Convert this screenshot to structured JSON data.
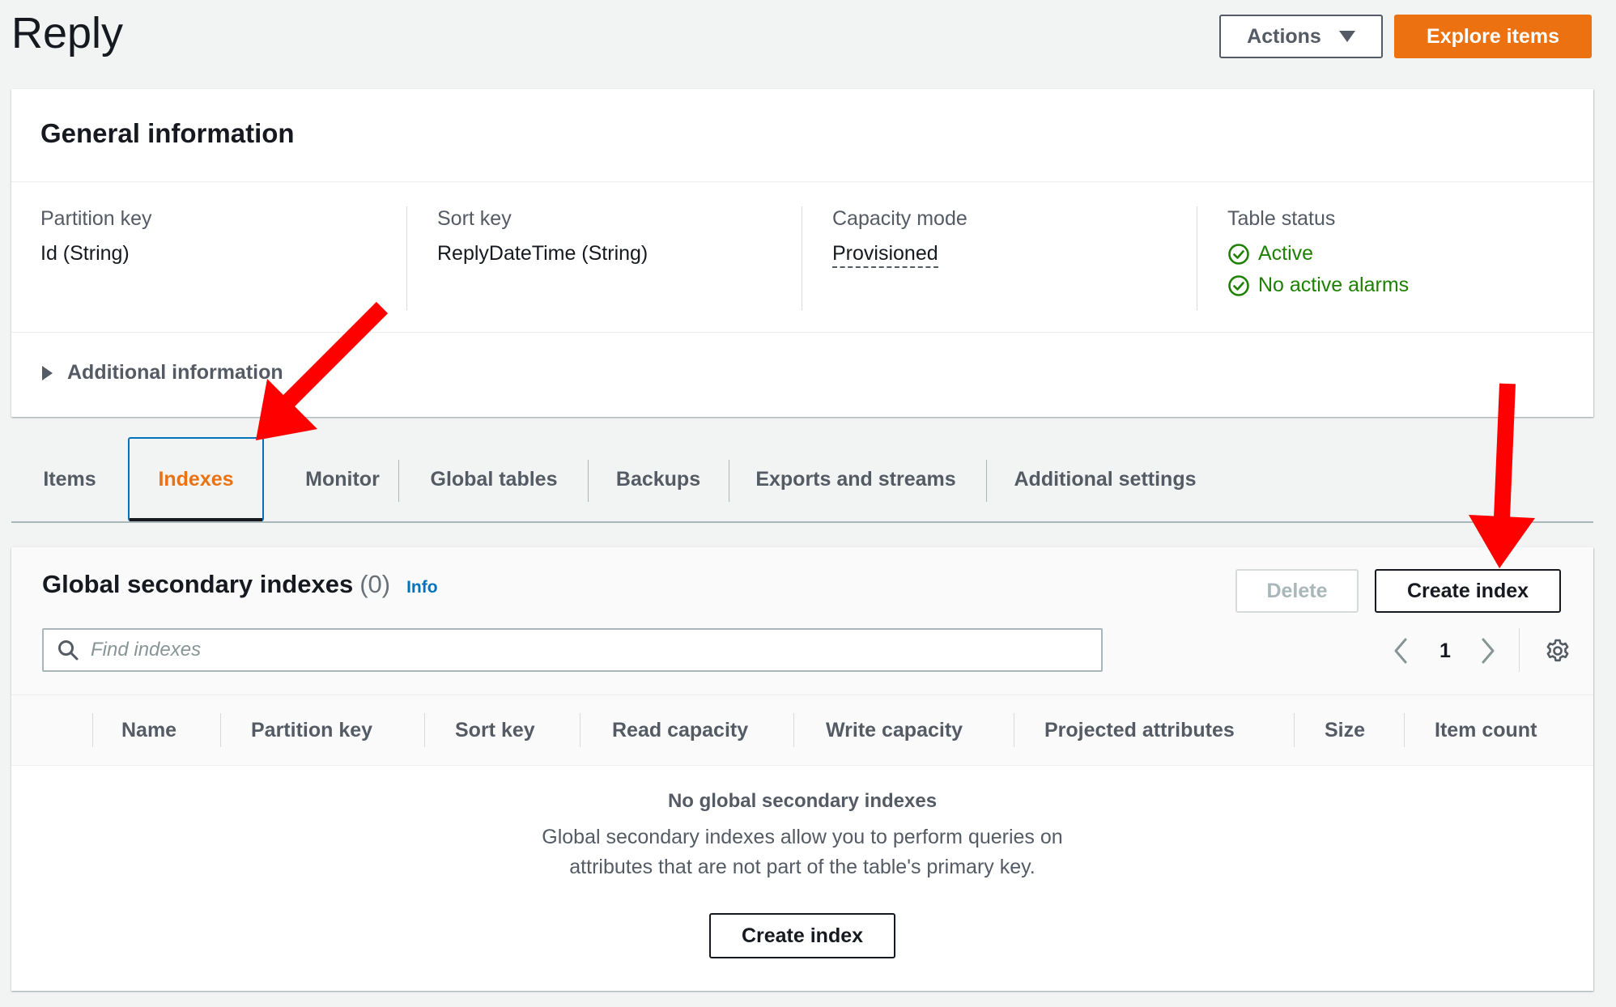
{
  "header": {
    "title": "Reply",
    "actions_label": "Actions",
    "explore_label": "Explore items"
  },
  "general": {
    "title": "General information",
    "partition_key_label": "Partition key",
    "partition_key_value": "Id (String)",
    "sort_key_label": "Sort key",
    "sort_key_value": "ReplyDateTime (String)",
    "capacity_label": "Capacity mode",
    "capacity_value": "Provisioned",
    "status_label": "Table status",
    "status_active": "Active",
    "status_alarms": "No active alarms",
    "additional_info": "Additional information"
  },
  "tabs": [
    {
      "label": "Items"
    },
    {
      "label": "Indexes"
    },
    {
      "label": "Monitor"
    },
    {
      "label": "Global tables"
    },
    {
      "label": "Backups"
    },
    {
      "label": "Exports and streams"
    },
    {
      "label": "Additional settings"
    }
  ],
  "active_tab": "Indexes",
  "gsi": {
    "title": "Global secondary indexes",
    "count": "(0)",
    "info": "Info",
    "delete_label": "Delete",
    "create_label": "Create index",
    "search_placeholder": "Find indexes",
    "page": "1",
    "columns": [
      "Name",
      "Partition key",
      "Sort key",
      "Read capacity",
      "Write capacity",
      "Projected attributes",
      "Size",
      "Item count"
    ],
    "empty_title": "No global secondary indexes",
    "empty_desc": "Global secondary indexes allow you to perform queries on attributes that are not part of the table's primary key.",
    "empty_create_label": "Create index"
  },
  "colors": {
    "accent_orange": "#ec7211",
    "success_green": "#1d8102",
    "link_blue": "#0073bb",
    "annotation_red": "#ff0000"
  },
  "icons": [
    "caret-down-icon",
    "check-circle-icon",
    "caret-right-icon",
    "search-icon",
    "chevron-left-icon",
    "chevron-right-icon",
    "gear-icon",
    "arrow-annotation"
  ]
}
